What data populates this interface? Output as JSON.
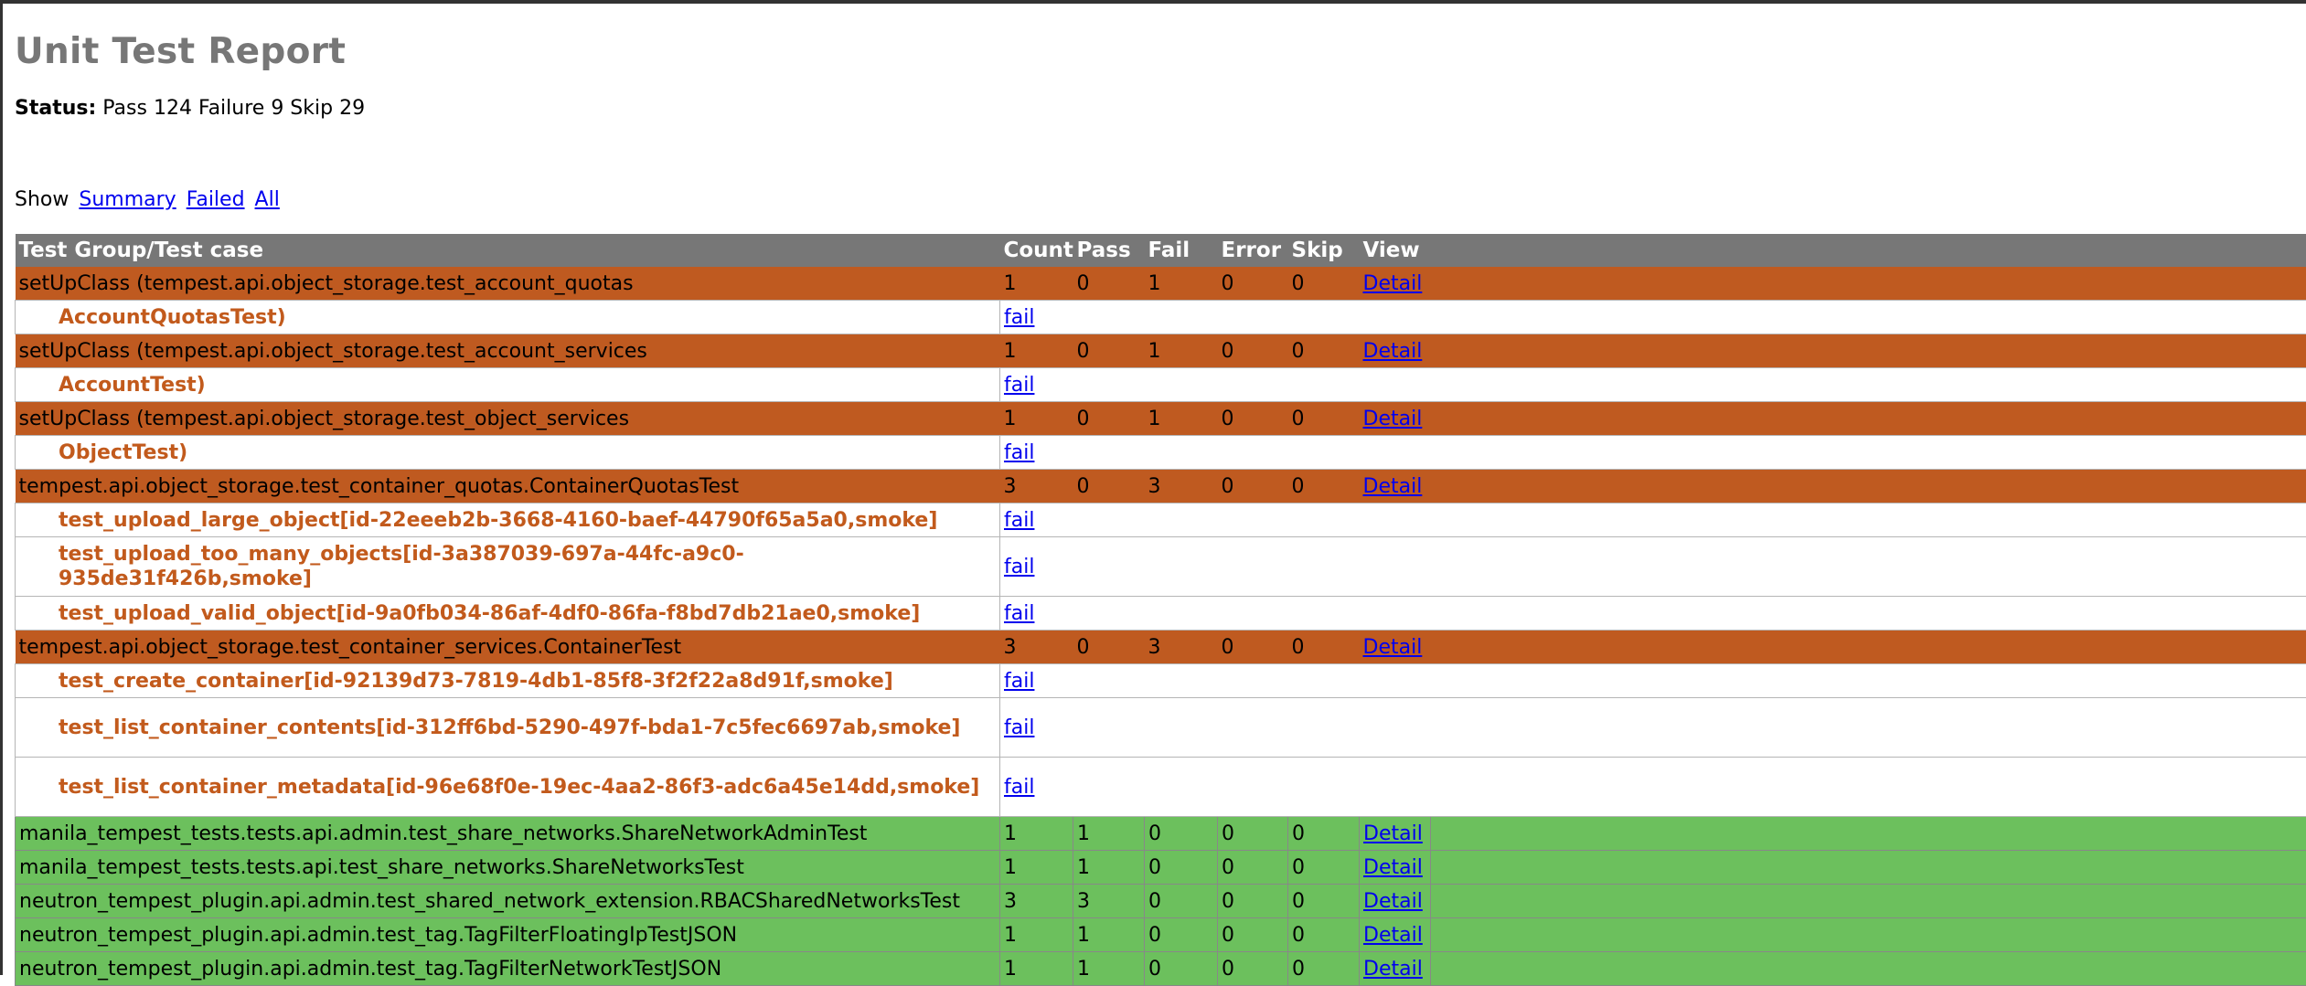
{
  "title": "Unit Test Report",
  "status": {
    "label": "Status:",
    "text": "Pass 124 Failure 9 Skip 29"
  },
  "filter": {
    "label": "Show",
    "links": [
      "Summary",
      "Failed",
      "All"
    ]
  },
  "table": {
    "headers": [
      "Test Group/Test case",
      "Count",
      "Pass",
      "Fail",
      "Error",
      "Skip",
      "View"
    ],
    "rows": [
      {
        "kind": "fail",
        "name": "setUpClass (tempest.api.object_storage.test_account_quotas",
        "count": "1",
        "pass": "0",
        "fail": "1",
        "error": "0",
        "skip": "0",
        "view": "Detail"
      },
      {
        "kind": "case",
        "name": "AccountQuotasTest)",
        "result": "fail"
      },
      {
        "kind": "fail",
        "name": "setUpClass (tempest.api.object_storage.test_account_services",
        "count": "1",
        "pass": "0",
        "fail": "1",
        "error": "0",
        "skip": "0",
        "view": "Detail"
      },
      {
        "kind": "case",
        "name": "AccountTest)",
        "result": "fail"
      },
      {
        "kind": "fail",
        "name": "setUpClass (tempest.api.object_storage.test_object_services",
        "count": "1",
        "pass": "0",
        "fail": "1",
        "error": "0",
        "skip": "0",
        "view": "Detail"
      },
      {
        "kind": "case",
        "name": "ObjectTest)",
        "result": "fail"
      },
      {
        "kind": "fail",
        "name": "tempest.api.object_storage.test_container_quotas.ContainerQuotasTest",
        "count": "3",
        "pass": "0",
        "fail": "3",
        "error": "0",
        "skip": "0",
        "view": "Detail"
      },
      {
        "kind": "case",
        "name": "test_upload_large_object[id-22eeeb2b-3668-4160-baef-44790f65a5a0,smoke]",
        "result": "fail"
      },
      {
        "kind": "case",
        "tall": true,
        "name": "test_upload_too_many_objects[id-3a387039-697a-44fc-a9c0-935de31f426b,smoke]",
        "result": "fail"
      },
      {
        "kind": "case",
        "name": "test_upload_valid_object[id-9a0fb034-86af-4df0-86fa-f8bd7db21ae0,smoke]",
        "result": "fail"
      },
      {
        "kind": "fail",
        "name": "tempest.api.object_storage.test_container_services.ContainerTest",
        "count": "3",
        "pass": "0",
        "fail": "3",
        "error": "0",
        "skip": "0",
        "view": "Detail"
      },
      {
        "kind": "case",
        "name": "test_create_container[id-92139d73-7819-4db1-85f8-3f2f22a8d91f,smoke]",
        "result": "fail"
      },
      {
        "kind": "case",
        "tall": true,
        "name": "test_list_container_contents[id-312ff6bd-5290-497f-bda1-7c5fec6697ab,smoke]",
        "result": "fail"
      },
      {
        "kind": "case",
        "tall": true,
        "name": "test_list_container_metadata[id-96e68f0e-19ec-4aa2-86f3-adc6a45e14dd,smoke]",
        "result": "fail"
      },
      {
        "kind": "pass",
        "name": "manila_tempest_tests.tests.api.admin.test_share_networks.ShareNetworkAdminTest",
        "count": "1",
        "pass": "1",
        "fail": "0",
        "error": "0",
        "skip": "0",
        "view": "Detail"
      },
      {
        "kind": "pass",
        "name": "manila_tempest_tests.tests.api.test_share_networks.ShareNetworksTest",
        "count": "1",
        "pass": "1",
        "fail": "0",
        "error": "0",
        "skip": "0",
        "view": "Detail"
      },
      {
        "kind": "pass",
        "name": "neutron_tempest_plugin.api.admin.test_shared_network_extension.RBACSharedNetworksTest",
        "count": "3",
        "pass": "3",
        "fail": "0",
        "error": "0",
        "skip": "0",
        "view": "Detail"
      },
      {
        "kind": "pass",
        "name": "neutron_tempest_plugin.api.admin.test_tag.TagFilterFloatingIpTestJSON",
        "count": "1",
        "pass": "1",
        "fail": "0",
        "error": "0",
        "skip": "0",
        "view": "Detail"
      },
      {
        "kind": "pass",
        "name": "neutron_tempest_plugin.api.admin.test_tag.TagFilterNetworkTestJSON",
        "count": "1",
        "pass": "1",
        "fail": "0",
        "error": "0",
        "skip": "0",
        "view": "Detail"
      }
    ]
  },
  "colors": {
    "fail_row": "#bf5a20",
    "pass_row": "#6cc05d",
    "header_row": "#777777",
    "case_text": "#c25a1c",
    "link": "#0000ee"
  }
}
